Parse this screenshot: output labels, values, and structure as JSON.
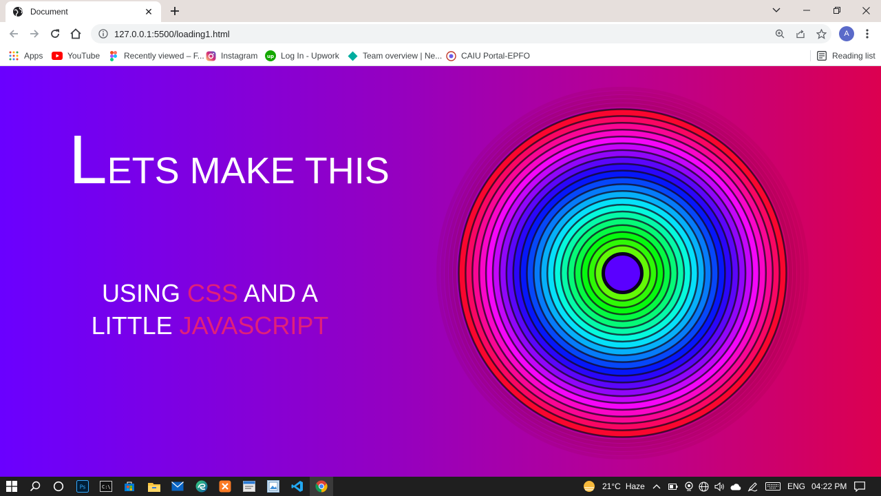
{
  "browser": {
    "tab": {
      "title": "Document",
      "icon": "globe-icon"
    },
    "address": {
      "url": "127.0.0.1:5500/loading1.html"
    },
    "profile_initial": "A",
    "bookmarks": [
      {
        "label": "Apps",
        "icon": "apps-grid-icon"
      },
      {
        "label": "YouTube",
        "icon": "youtube-icon"
      },
      {
        "label": "Recently viewed – F...",
        "icon": "figma-icon"
      },
      {
        "label": "Instagram",
        "icon": "instagram-icon"
      },
      {
        "label": "Log In - Upwork",
        "icon": "upwork-icon"
      },
      {
        "label": "Team overview | Ne...",
        "icon": "diamond-icon"
      },
      {
        "label": "CAIU Portal-EPFO",
        "icon": "epfo-icon"
      }
    ],
    "reading_list": "Reading list"
  },
  "page": {
    "headline_first": "L",
    "headline_rest": "ETS MAKE THIS",
    "sub_using": "USING ",
    "sub_css": "CSS",
    "sub_and": " AND A",
    "sub_little": "LITTLE ",
    "sub_js": "JAVASCRIPT",
    "colors": {
      "highlight": "#e0207a",
      "gradient_start": "#6a00ff",
      "gradient_end": "#dc0050"
    }
  },
  "taskbar": {
    "weather_temp": "21°C",
    "weather_text": "Haze",
    "language": "ENG",
    "time": "04:22 PM"
  }
}
